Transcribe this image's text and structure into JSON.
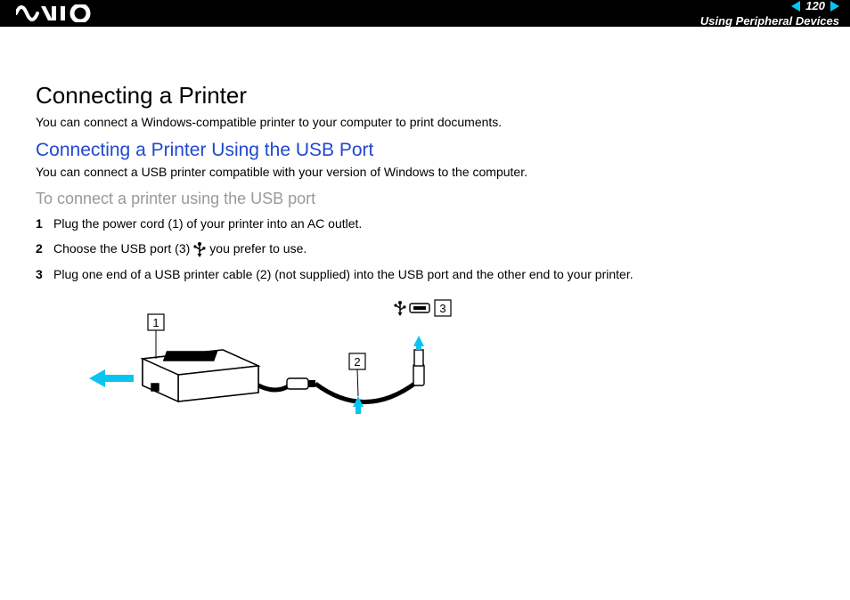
{
  "header": {
    "page_number": "120",
    "section_title": "Using Peripheral Devices"
  },
  "content": {
    "title": "Connecting a Printer",
    "intro": "You can connect a Windows-compatible printer to your computer to print documents.",
    "subtitle": "Connecting a Printer Using the USB Port",
    "sub_intro": "You can connect a USB printer compatible with your version of Windows to the computer.",
    "task_title": "To connect a printer using the USB port",
    "steps": {
      "s1": {
        "num": "1",
        "text": "Plug the power cord (1) of your printer into an AC outlet."
      },
      "s2": {
        "num": "2",
        "text_a": "Choose the USB port (3) ",
        "text_b": " you prefer to use."
      },
      "s3": {
        "num": "3",
        "text": "Plug one end of a USB printer cable (2) (not supplied) into the USB port and the other end to your printer."
      }
    }
  },
  "diagram": {
    "labels": {
      "l1": "1",
      "l2": "2",
      "l3": "3"
    }
  }
}
